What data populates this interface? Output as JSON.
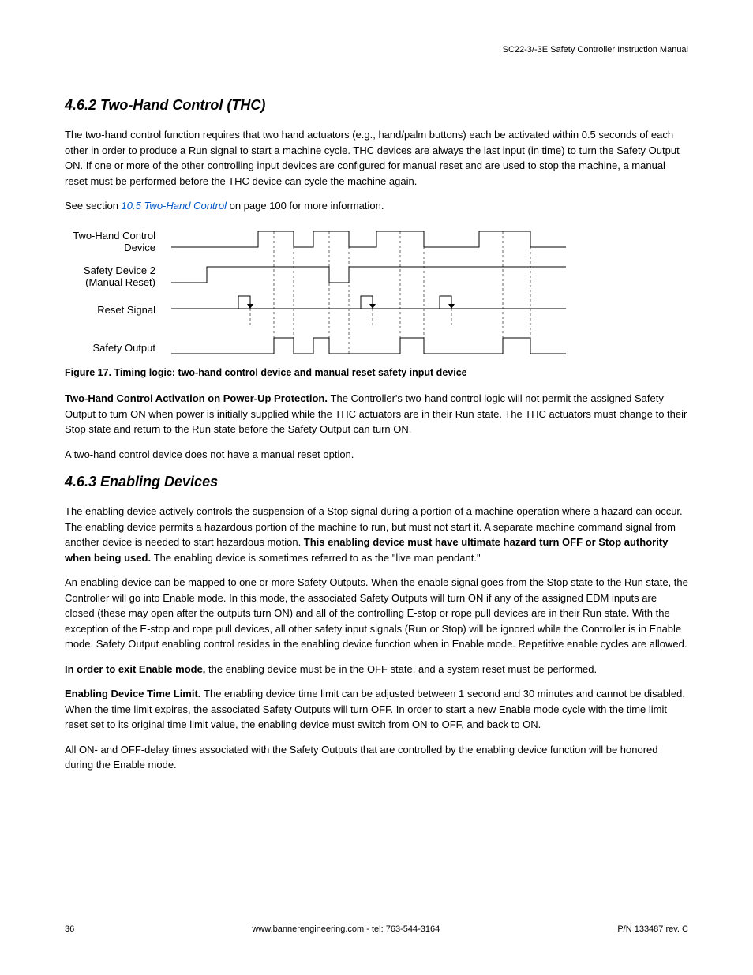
{
  "header": {
    "doc_title": "SC22-3/-3E Safety Controller Instruction Manual"
  },
  "section1": {
    "heading": "4.6.2 Two-Hand Control (THC)",
    "para1": "The two-hand control function requires that two hand actuators (e.g., hand/palm buttons) each be activated within 0.5 seconds of each other in order to produce a Run signal to start a machine cycle. THC devices are always the last input (in time) to turn the Safety Output ON. If one or more of the other controlling input devices are configured for manual reset and are used to stop the machine, a manual reset must be performed before the THC device can cycle the machine again.",
    "para2_pre": "See section ",
    "para2_link": "10.5 Two-Hand Control",
    "para2_post": " on page 100 for more information."
  },
  "figure": {
    "labels": {
      "row1": "Two-Hand Control Device",
      "row2": "Safety Device 2 (Manual Reset)",
      "row3": "Reset Signal",
      "row4": "Safety Output"
    },
    "caption": "Figure 17. Timing logic: two-hand control device and manual reset safety input device"
  },
  "section1b": {
    "para3_bold": "Two-Hand Control Activation on Power-Up Protection. ",
    "para3": "The Controller's two-hand control logic will not permit the assigned Safety Output to turn ON when power is initially supplied while the THC actuators are in their Run state. The THC actuators must change to their Stop state and return to the Run state before the Safety Output can turn ON.",
    "para4": "A two-hand control device does not have a manual reset option."
  },
  "section2": {
    "heading": "4.6.3 Enabling Devices",
    "para1_pre": "The enabling device actively controls the suspension of a Stop signal during a portion of a machine operation where a hazard can occur. The enabling device permits a hazardous portion of the machine to run, but must not start it. A separate machine command signal from another device is needed to start hazardous motion. ",
    "para1_bold": "This enabling device must have ultimate hazard turn OFF or Stop authority when being used. ",
    "para1_post": "The enabling device is sometimes referred to as the \"live man pendant.\"",
    "para2": "An enabling device can be mapped to one or more Safety Outputs. When the enable signal goes from the Stop state to the Run state, the Controller will go into Enable mode. In this mode, the associated Safety Outputs will turn ON if any of the assigned EDM inputs are closed (these may open after the outputs turn ON) and all of the controlling E-stop or rope pull devices are in their Run state. With the exception of the E-stop and rope pull devices, all other safety input signals (Run or Stop) will be ignored while the Controller is in Enable mode. Safety Output enabling control resides in the enabling device function when in Enable mode. Repetitive enable cycles are allowed.",
    "para3_bold": "In order to exit Enable mode, ",
    "para3": "the enabling device must be in the OFF state, and a system reset must be performed.",
    "para4_bold": "Enabling Device Time Limit. ",
    "para4": "The enabling device time limit can be adjusted between 1 second and 30 minutes and cannot be disabled. When the time limit expires, the associated Safety Outputs will turn OFF. In order to start a new Enable mode cycle with the time limit reset set to its original time limit value, the enabling device must switch from ON to OFF, and back to ON.",
    "para5": "All ON- and OFF-delay times associated with the Safety Outputs that are controlled by the enabling device function will be honored during the Enable mode."
  },
  "footer": {
    "page": "36",
    "center": "www.bannerengineering.com - tel: 763-544-3164",
    "right": "P/N 133487 rev. C"
  },
  "chart_data": {
    "type": "timing_diagram",
    "signals": [
      {
        "name": "Two-Hand Control Device",
        "transitions": [
          0,
          0,
          1,
          1,
          0,
          0,
          1,
          1,
          0,
          0,
          1,
          1,
          0,
          0,
          1,
          1,
          0,
          0,
          1,
          1
        ]
      },
      {
        "name": "Safety Device 2 (Manual Reset)",
        "transitions": [
          0,
          0,
          1,
          1,
          1,
          1,
          1,
          0,
          0,
          1,
          1,
          1,
          1,
          1,
          1,
          1,
          1,
          1,
          1,
          1
        ]
      },
      {
        "name": "Reset Signal",
        "is_pulse": true,
        "pulse_positions": [
          3,
          9,
          12
        ]
      },
      {
        "name": "Safety Output",
        "transitions": [
          0,
          0,
          0,
          0,
          0,
          0,
          1,
          1,
          0,
          0,
          1,
          1,
          0,
          0,
          0,
          0,
          0,
          0,
          1,
          1
        ]
      }
    ]
  }
}
